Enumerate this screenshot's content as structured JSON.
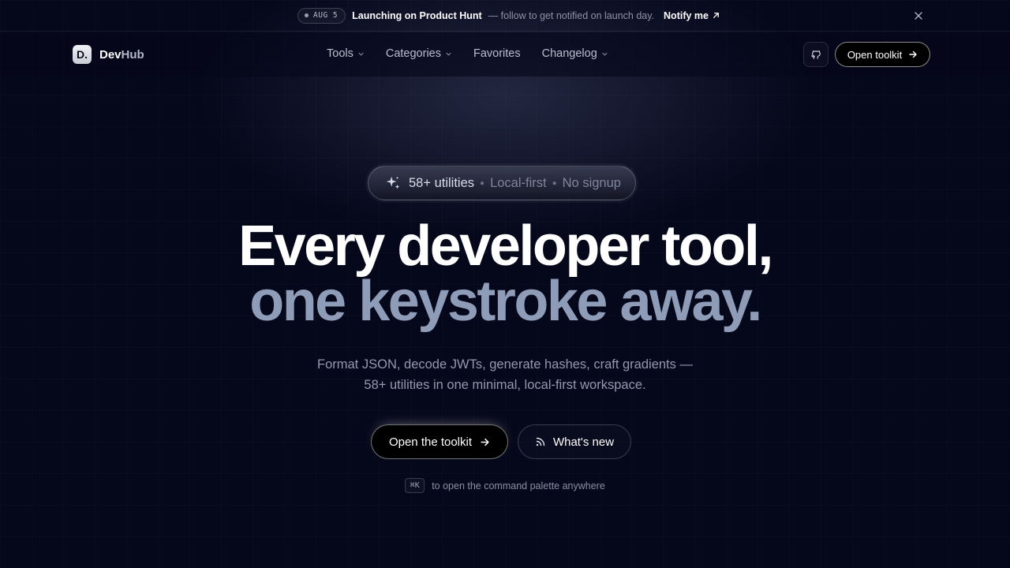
{
  "announcement": {
    "date": "AUG 5",
    "headline": "Launching on Product Hunt",
    "text": "— follow to get notified on launch day.",
    "cta": "Notify me",
    "close_icon": "close-icon"
  },
  "header": {
    "logo_letter": "D.",
    "brand_dev": "Dev",
    "brand_hub": "Hub",
    "nav": [
      {
        "label": "Tools",
        "has_dropdown": true
      },
      {
        "label": "Categories",
        "has_dropdown": true
      },
      {
        "label": "Favorites",
        "has_dropdown": false
      },
      {
        "label": "Changelog",
        "has_dropdown": true
      }
    ],
    "github_icon": "github-icon",
    "open_button": "Open toolkit"
  },
  "hero": {
    "badge": {
      "count": "58+ utilities",
      "feature1": "Local-first",
      "feature2": "No signup",
      "icon": "sparkle-icon"
    },
    "title_line1": "Every developer tool,",
    "title_line2": "one keystroke away.",
    "subtitle_line1": "Format JSON, decode JWTs, generate hashes, craft gradients —",
    "subtitle_line2": "58+ utilities in one minimal, local-first workspace.",
    "primary_cta": "Open the toolkit",
    "secondary_cta": "What's new",
    "secondary_icon": "rss-icon",
    "shortcut_key": "⌘K",
    "shortcut_text": "to open the command palette anywhere"
  },
  "colors": {
    "background": "#05071a",
    "title_primary": "#ffffff",
    "title_secondary": "#8f9cb8",
    "muted_text": "#9499ad"
  }
}
